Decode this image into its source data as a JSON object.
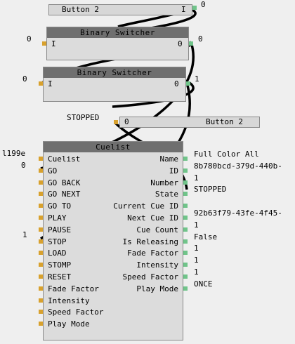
{
  "button_top": {
    "label": "Button 2",
    "pin_text": "I",
    "out_value": "0"
  },
  "switcher1": {
    "title": "Binary Switcher",
    "in_value": "0",
    "in_label": "I",
    "out_label": "0",
    "out_value": "0"
  },
  "switcher2": {
    "title": "Binary Switcher",
    "in_value": "0",
    "in_label": "I",
    "out_label": "0",
    "out_value": "1"
  },
  "stopped_label": "STOPPED",
  "button_bottom": {
    "label": "Button 2",
    "value": "0"
  },
  "cuelist": {
    "title": "Cuelist",
    "left_outside_values": {
      "cuelist": "l199e",
      "go": "0",
      "stop": "1"
    },
    "inputs": [
      "Cuelist",
      "GO",
      "GO BACK",
      "GO NEXT",
      "GO TO",
      "PLAY",
      "PAUSE",
      "STOP",
      "LOAD",
      "STOMP",
      "RESET",
      "Fade Factor",
      "Intensity",
      "Speed Factor",
      "Play Mode"
    ],
    "outputs": [
      "Name",
      "ID",
      "Number",
      "State",
      "Current Cue ID",
      "Next Cue ID",
      "Cue Count",
      "Is Releasing",
      "Fade Factor",
      "Intensity",
      "Speed Factor",
      "Play Mode"
    ],
    "output_values": [
      "Full Color All",
      "8b780bcd-379d-440b-",
      "1",
      "STOPPED",
      "92b63f79-43fe-4f45-",
      "1",
      "False",
      "1",
      "1",
      "1",
      "ONCE"
    ]
  },
  "colors": {
    "wire": "#000000",
    "input_pin": "#d8a12e",
    "output_pin": "#70c48a",
    "node_bg": "#dcdcdc",
    "title_bg": "#6f6f6f"
  }
}
